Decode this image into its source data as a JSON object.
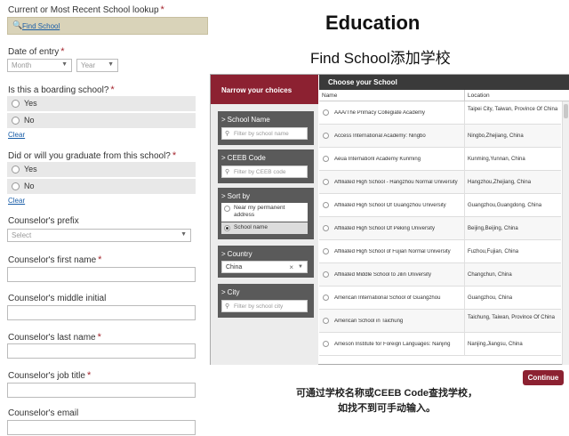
{
  "form": {
    "school_lookup": {
      "label": "Current or Most Recent School lookup",
      "required": "*",
      "link": "Find School"
    },
    "date_of_entry": {
      "label": "Date of entry",
      "required": "*",
      "month": "Month",
      "year": "Year"
    },
    "boarding": {
      "label": "Is this a boarding school?",
      "required": "*",
      "options": [
        "Yes",
        "No"
      ],
      "clear": "Clear"
    },
    "graduate": {
      "label": "Did or will you graduate from this school?",
      "required": "*",
      "options": [
        "Yes",
        "No"
      ],
      "clear": "Clear"
    },
    "prefix": {
      "label": "Counselor's prefix",
      "placeholder": "Select"
    },
    "first_name": {
      "label": "Counselor's first name",
      "required": "*"
    },
    "middle_initial": {
      "label": "Counselor's middle initial"
    },
    "last_name": {
      "label": "Counselor's last name",
      "required": "*"
    },
    "job_title": {
      "label": "Counselor's job title",
      "required": "*"
    },
    "email": {
      "label": "Counselor's email"
    }
  },
  "slide": {
    "title": "Education",
    "subtitle": "Find School添加学校",
    "note_line1": "可通过学校名称或CEEB Code查找学校，",
    "note_line2": "如找不到可手动输入。"
  },
  "finder": {
    "nav_title": "Narrow your choices",
    "school_name": {
      "label": "School Name",
      "placeholder": "Filter by school name"
    },
    "ceeb": {
      "label": "CEEB Code",
      "placeholder": "Filter by CEEB code"
    },
    "sort": {
      "label": "Sort by",
      "options": [
        "Near my permanent address",
        "School name"
      ]
    },
    "country": {
      "label": "Country",
      "value": "China"
    },
    "city": {
      "label": "City",
      "placeholder": "Filter by school city"
    },
    "list_title": "Choose your School",
    "col_name": "Name",
    "col_location": "Location",
    "schools": [
      {
        "name": "AAA/The Primacy Collegiate Academy",
        "location": "Taipei City, Taiwan, Province Of China"
      },
      {
        "name": "Access International Academy: Ningbo",
        "location": "Ningbo,Zhejiang, China"
      },
      {
        "name": "Aeua Internationl Academy Kunming",
        "location": "Kunming,Yunnan, China"
      },
      {
        "name": "Affiliated High School - Hangzhou Normal University",
        "location": "Hangzhou,Zhejiang, China"
      },
      {
        "name": "Affiliated High School Of Guangzhou University",
        "location": "Guangzhou,Guangdong, China"
      },
      {
        "name": "Affiliated High School Of Peking University",
        "location": "Beijing,Beijing, China"
      },
      {
        "name": "Affiliated High School of Fujian Normal University",
        "location": "Fuzhou,Fujian, China"
      },
      {
        "name": "Affiliated Middle School to Jilin University",
        "location": "Changchun, China"
      },
      {
        "name": "American International School of Guangzhou",
        "location": "Guangzhou, China"
      },
      {
        "name": "American School in Taichung",
        "location": "Taichung, Taiwan, Province Of China"
      },
      {
        "name": "Ameson Institute for Foreign Languages: Nanjing",
        "location": "Nanjing,Jiangsu, China"
      }
    ],
    "continue": "Continue"
  }
}
